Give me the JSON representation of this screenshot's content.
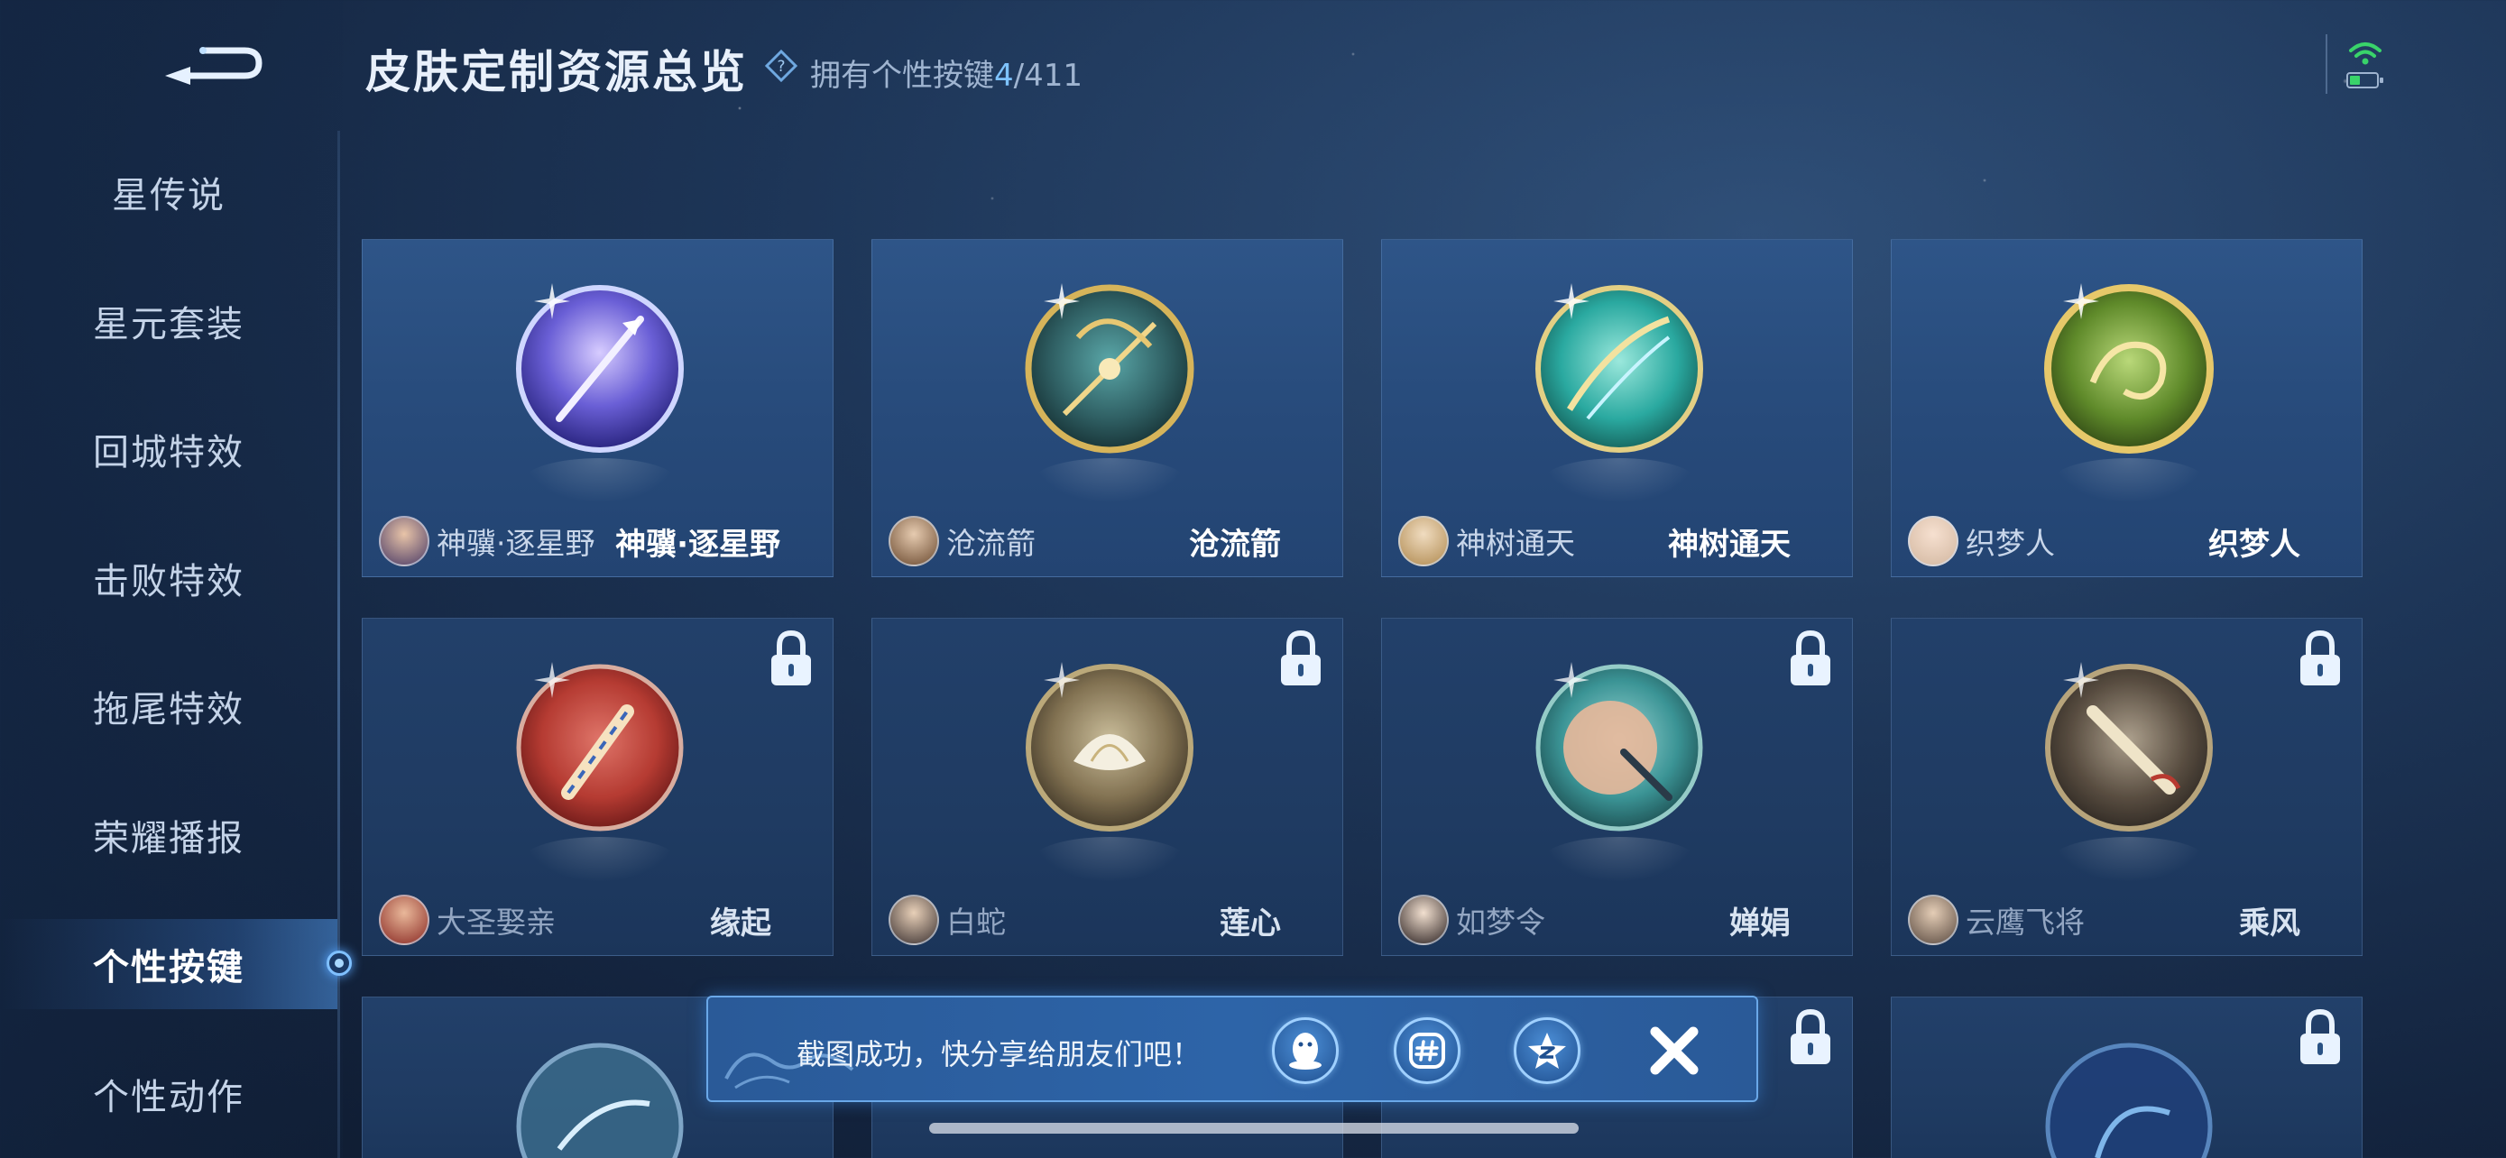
{
  "header": {
    "title": "皮肤定制资源总览",
    "owned_prefix": "拥有个性按键",
    "owned_count": "4",
    "owned_total": "/411"
  },
  "sidebar": {
    "items": [
      {
        "label": "星传说",
        "active": false
      },
      {
        "label": "星元套装",
        "active": false
      },
      {
        "label": "回城特效",
        "active": false
      },
      {
        "label": "击败特效",
        "active": false
      },
      {
        "label": "拖尾特效",
        "active": false
      },
      {
        "label": "荣耀播报",
        "active": false
      },
      {
        "label": "个性按键",
        "active": true
      },
      {
        "label": "个性动作",
        "active": false
      }
    ]
  },
  "cards": [
    {
      "hero": "神骥·逐星野",
      "skin": "神骥·逐星野",
      "locked": false,
      "palette": "#6a5fd6"
    },
    {
      "hero": "沧流箭",
      "skin": "沧流箭",
      "locked": false,
      "palette": "#2f5f63"
    },
    {
      "hero": "神树通天",
      "skin": "神树通天",
      "locked": false,
      "palette": "#2aa9a0"
    },
    {
      "hero": "织梦人",
      "skin": "织梦人",
      "locked": false,
      "palette": "#5f8a2a"
    },
    {
      "hero": "大圣娶亲",
      "skin": "缘起",
      "locked": true,
      "palette": "#c23b2e"
    },
    {
      "hero": "白蛇",
      "skin": "莲心",
      "locked": true,
      "palette": "#8a7650"
    },
    {
      "hero": "如梦令",
      "skin": "婵娟",
      "locked": true,
      "palette": "#3e9c9a"
    },
    {
      "hero": "云鹰飞将",
      "skin": "乘风",
      "locked": true,
      "palette": "#5e4f3e"
    }
  ],
  "toast": {
    "message": "截图成功，快分享给朋友们吧！"
  },
  "icons": {
    "back": "back-arrow-icon",
    "help": "question-diamond-icon",
    "wifi": "wifi-icon",
    "battery": "battery-icon",
    "lock": "lock-icon",
    "qq": "qq-penguin-icon",
    "hash": "hashtag-icon",
    "qzone": "qzone-star-icon",
    "close": "close-icon"
  }
}
